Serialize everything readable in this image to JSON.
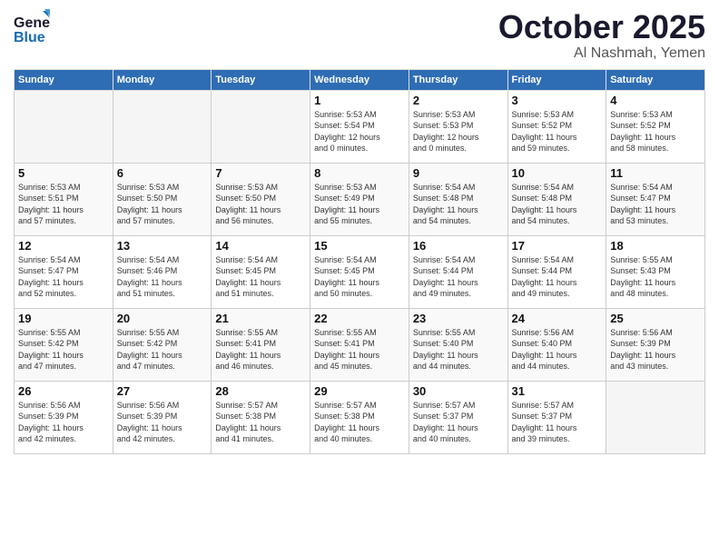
{
  "header": {
    "logo_general": "General",
    "logo_blue": "Blue",
    "month": "October 2025",
    "location": "Al Nashmah, Yemen"
  },
  "days_of_week": [
    "Sunday",
    "Monday",
    "Tuesday",
    "Wednesday",
    "Thursday",
    "Friday",
    "Saturday"
  ],
  "weeks": [
    [
      {
        "day": "",
        "info": ""
      },
      {
        "day": "",
        "info": ""
      },
      {
        "day": "",
        "info": ""
      },
      {
        "day": "1",
        "info": "Sunrise: 5:53 AM\nSunset: 5:54 PM\nDaylight: 12 hours\nand 0 minutes."
      },
      {
        "day": "2",
        "info": "Sunrise: 5:53 AM\nSunset: 5:53 PM\nDaylight: 12 hours\nand 0 minutes."
      },
      {
        "day": "3",
        "info": "Sunrise: 5:53 AM\nSunset: 5:52 PM\nDaylight: 11 hours\nand 59 minutes."
      },
      {
        "day": "4",
        "info": "Sunrise: 5:53 AM\nSunset: 5:52 PM\nDaylight: 11 hours\nand 58 minutes."
      }
    ],
    [
      {
        "day": "5",
        "info": "Sunrise: 5:53 AM\nSunset: 5:51 PM\nDaylight: 11 hours\nand 57 minutes."
      },
      {
        "day": "6",
        "info": "Sunrise: 5:53 AM\nSunset: 5:50 PM\nDaylight: 11 hours\nand 57 minutes."
      },
      {
        "day": "7",
        "info": "Sunrise: 5:53 AM\nSunset: 5:50 PM\nDaylight: 11 hours\nand 56 minutes."
      },
      {
        "day": "8",
        "info": "Sunrise: 5:53 AM\nSunset: 5:49 PM\nDaylight: 11 hours\nand 55 minutes."
      },
      {
        "day": "9",
        "info": "Sunrise: 5:54 AM\nSunset: 5:48 PM\nDaylight: 11 hours\nand 54 minutes."
      },
      {
        "day": "10",
        "info": "Sunrise: 5:54 AM\nSunset: 5:48 PM\nDaylight: 11 hours\nand 54 minutes."
      },
      {
        "day": "11",
        "info": "Sunrise: 5:54 AM\nSunset: 5:47 PM\nDaylight: 11 hours\nand 53 minutes."
      }
    ],
    [
      {
        "day": "12",
        "info": "Sunrise: 5:54 AM\nSunset: 5:47 PM\nDaylight: 11 hours\nand 52 minutes."
      },
      {
        "day": "13",
        "info": "Sunrise: 5:54 AM\nSunset: 5:46 PM\nDaylight: 11 hours\nand 51 minutes."
      },
      {
        "day": "14",
        "info": "Sunrise: 5:54 AM\nSunset: 5:45 PM\nDaylight: 11 hours\nand 51 minutes."
      },
      {
        "day": "15",
        "info": "Sunrise: 5:54 AM\nSunset: 5:45 PM\nDaylight: 11 hours\nand 50 minutes."
      },
      {
        "day": "16",
        "info": "Sunrise: 5:54 AM\nSunset: 5:44 PM\nDaylight: 11 hours\nand 49 minutes."
      },
      {
        "day": "17",
        "info": "Sunrise: 5:54 AM\nSunset: 5:44 PM\nDaylight: 11 hours\nand 49 minutes."
      },
      {
        "day": "18",
        "info": "Sunrise: 5:55 AM\nSunset: 5:43 PM\nDaylight: 11 hours\nand 48 minutes."
      }
    ],
    [
      {
        "day": "19",
        "info": "Sunrise: 5:55 AM\nSunset: 5:42 PM\nDaylight: 11 hours\nand 47 minutes."
      },
      {
        "day": "20",
        "info": "Sunrise: 5:55 AM\nSunset: 5:42 PM\nDaylight: 11 hours\nand 47 minutes."
      },
      {
        "day": "21",
        "info": "Sunrise: 5:55 AM\nSunset: 5:41 PM\nDaylight: 11 hours\nand 46 minutes."
      },
      {
        "day": "22",
        "info": "Sunrise: 5:55 AM\nSunset: 5:41 PM\nDaylight: 11 hours\nand 45 minutes."
      },
      {
        "day": "23",
        "info": "Sunrise: 5:55 AM\nSunset: 5:40 PM\nDaylight: 11 hours\nand 44 minutes."
      },
      {
        "day": "24",
        "info": "Sunrise: 5:56 AM\nSunset: 5:40 PM\nDaylight: 11 hours\nand 44 minutes."
      },
      {
        "day": "25",
        "info": "Sunrise: 5:56 AM\nSunset: 5:39 PM\nDaylight: 11 hours\nand 43 minutes."
      }
    ],
    [
      {
        "day": "26",
        "info": "Sunrise: 5:56 AM\nSunset: 5:39 PM\nDaylight: 11 hours\nand 42 minutes."
      },
      {
        "day": "27",
        "info": "Sunrise: 5:56 AM\nSunset: 5:39 PM\nDaylight: 11 hours\nand 42 minutes."
      },
      {
        "day": "28",
        "info": "Sunrise: 5:57 AM\nSunset: 5:38 PM\nDaylight: 11 hours\nand 41 minutes."
      },
      {
        "day": "29",
        "info": "Sunrise: 5:57 AM\nSunset: 5:38 PM\nDaylight: 11 hours\nand 40 minutes."
      },
      {
        "day": "30",
        "info": "Sunrise: 5:57 AM\nSunset: 5:37 PM\nDaylight: 11 hours\nand 40 minutes."
      },
      {
        "day": "31",
        "info": "Sunrise: 5:57 AM\nSunset: 5:37 PM\nDaylight: 11 hours\nand 39 minutes."
      },
      {
        "day": "",
        "info": ""
      }
    ]
  ]
}
